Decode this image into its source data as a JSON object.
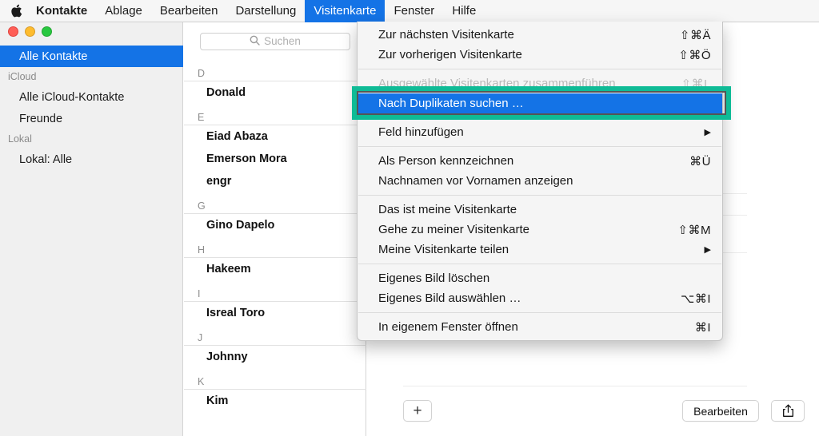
{
  "menubar": {
    "apple_icon": "apple-logo-icon",
    "items": [
      {
        "label": "Kontakte",
        "bold": true,
        "active": false
      },
      {
        "label": "Ablage",
        "bold": false,
        "active": false
      },
      {
        "label": "Bearbeiten",
        "bold": false,
        "active": false
      },
      {
        "label": "Darstellung",
        "bold": false,
        "active": false
      },
      {
        "label": "Visitenkarte",
        "bold": false,
        "active": true
      },
      {
        "label": "Fenster",
        "bold": false,
        "active": false
      },
      {
        "label": "Hilfe",
        "bold": false,
        "active": false
      }
    ]
  },
  "window_controls": {
    "close": "close-button",
    "minimize": "minimize-button",
    "zoom": "zoom-button"
  },
  "sidebar": {
    "rows": [
      {
        "type": "item",
        "label": "Alle Kontakte",
        "selected": true
      },
      {
        "type": "header",
        "label": "iCloud",
        "selected": false
      },
      {
        "type": "item",
        "label": "Alle iCloud-Kontakte",
        "selected": false
      },
      {
        "type": "item",
        "label": "Freunde",
        "selected": false
      },
      {
        "type": "header",
        "label": "Lokal",
        "selected": false
      },
      {
        "type": "item",
        "label": "Lokal: Alle",
        "selected": false
      }
    ]
  },
  "search": {
    "placeholder": "Suchen",
    "value": "",
    "icon": "search-icon"
  },
  "contacts": [
    {
      "type": "letter",
      "label": "D"
    },
    {
      "type": "contact",
      "label": "Donald"
    },
    {
      "type": "letter",
      "label": "E"
    },
    {
      "type": "contact",
      "label": "Eiad Abaza"
    },
    {
      "type": "contact",
      "label": "Emerson Mora"
    },
    {
      "type": "contact",
      "label": "engr"
    },
    {
      "type": "letter",
      "label": "G"
    },
    {
      "type": "contact",
      "label": "Gino Dapelo"
    },
    {
      "type": "letter",
      "label": "H"
    },
    {
      "type": "contact",
      "label": "Hakeem"
    },
    {
      "type": "letter",
      "label": "I"
    },
    {
      "type": "contact",
      "label": "Isreal Toro"
    },
    {
      "type": "letter",
      "label": "J"
    },
    {
      "type": "contact",
      "label": "Johnny"
    },
    {
      "type": "letter",
      "label": "K"
    },
    {
      "type": "contact",
      "label": "Kim"
    }
  ],
  "detail_toolbar": {
    "add_label": "+",
    "edit_label": "Bearbeiten",
    "share_icon": "share-icon"
  },
  "dropdown": {
    "title": "Visitenkarte",
    "items": [
      {
        "type": "item",
        "label": "Zur nächsten Visitenkarte",
        "shortcut": "⇧⌘Ä",
        "arrow": "",
        "state": "normal"
      },
      {
        "type": "item",
        "label": "Zur vorherigen Visitenkarte",
        "shortcut": "⇧⌘Ö",
        "arrow": "",
        "state": "normal"
      },
      {
        "type": "separator",
        "label": "",
        "shortcut": "",
        "arrow": "",
        "state": "normal"
      },
      {
        "type": "item",
        "label": "Ausgewählte Visitenkarten zusammenführen",
        "shortcut": "⇧⌘L",
        "arrow": "",
        "state": "disabled"
      },
      {
        "type": "item",
        "label": "Nach Duplikaten suchen …",
        "shortcut": "",
        "arrow": "",
        "state": "highlighted"
      },
      {
        "type": "separator",
        "label": "",
        "shortcut": "",
        "arrow": "",
        "state": "normal"
      },
      {
        "type": "item",
        "label": "Feld hinzufügen",
        "shortcut": "",
        "arrow": "▶",
        "state": "normal"
      },
      {
        "type": "separator",
        "label": "",
        "shortcut": "",
        "arrow": "",
        "state": "normal"
      },
      {
        "type": "item",
        "label": "Als Person kennzeichnen",
        "shortcut": "⌘Ü",
        "arrow": "",
        "state": "normal"
      },
      {
        "type": "item",
        "label": "Nachnamen vor Vornamen anzeigen",
        "shortcut": "",
        "arrow": "",
        "state": "normal"
      },
      {
        "type": "separator",
        "label": "",
        "shortcut": "",
        "arrow": "",
        "state": "normal"
      },
      {
        "type": "item",
        "label": "Das ist meine Visitenkarte",
        "shortcut": "",
        "arrow": "",
        "state": "normal"
      },
      {
        "type": "item",
        "label": "Gehe zu meiner Visitenkarte",
        "shortcut": "⇧⌘M",
        "arrow": "",
        "state": "normal"
      },
      {
        "type": "item",
        "label": "Meine Visitenkarte teilen",
        "shortcut": "",
        "arrow": "▶",
        "state": "normal"
      },
      {
        "type": "separator",
        "label": "",
        "shortcut": "",
        "arrow": "",
        "state": "normal"
      },
      {
        "type": "item",
        "label": "Eigenes Bild löschen",
        "shortcut": "",
        "arrow": "",
        "state": "normal"
      },
      {
        "type": "item",
        "label": "Eigenes Bild auswählen …",
        "shortcut": "⌥⌘I",
        "arrow": "",
        "state": "normal"
      },
      {
        "type": "separator",
        "label": "",
        "shortcut": "",
        "arrow": "",
        "state": "normal"
      },
      {
        "type": "item",
        "label": "In eigenem Fenster öffnen",
        "shortcut": "⌘I",
        "arrow": "",
        "state": "normal"
      }
    ]
  },
  "annotation": {
    "highlight_color": "#0fbb96",
    "target_label": "Nach Duplikaten suchen …"
  },
  "colors": {
    "accent": "#1473e6",
    "menubar_bg": "#f6f6f6",
    "sidebar_bg": "#f0f0f0",
    "menu_bg": "#f5f5f5"
  }
}
